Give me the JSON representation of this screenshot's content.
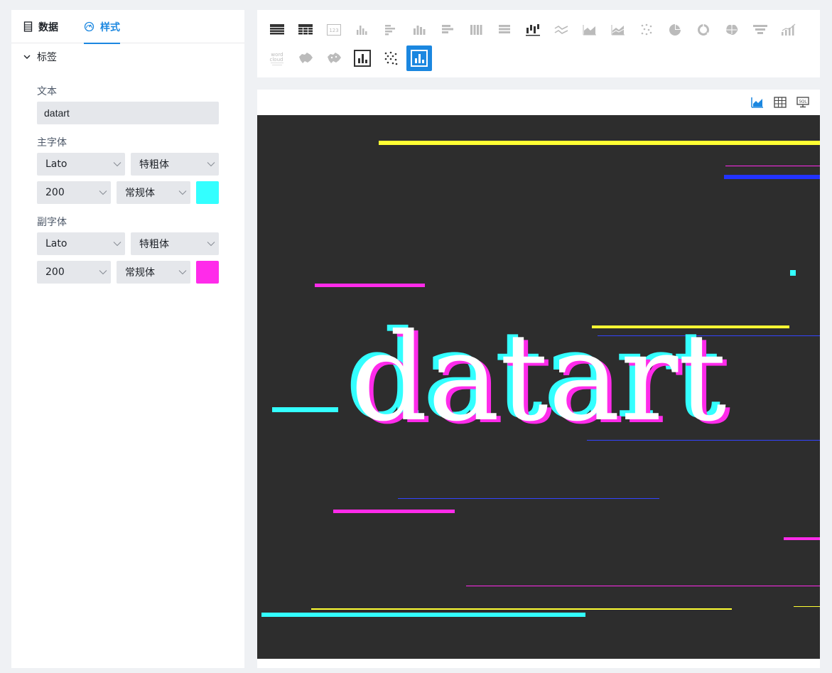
{
  "tabs": {
    "data": "数据",
    "style": "样式"
  },
  "section": {
    "label": "标签"
  },
  "fields": {
    "text_label": "文本",
    "text_value": "datart",
    "main_font_label": "主字体",
    "sub_font_label": "副字体"
  },
  "main_font": {
    "family": "Lato",
    "weight": "特粗体",
    "size": "200",
    "style": "常规体",
    "color": "#33ffff"
  },
  "sub_font": {
    "family": "Lato",
    "weight": "特粗体",
    "size": "200",
    "style": "常规体",
    "color": "#ff2bea"
  },
  "chart_icons": [
    "basic-table-icon",
    "pivot-table-icon",
    "scorecard-icon",
    "cluster-column-icon",
    "cluster-bar-icon",
    "stack-column-icon",
    "stack-bar-icon",
    "percent-column-icon",
    "percent-bar-icon",
    "waterfall-icon",
    "line-icon",
    "area-icon",
    "stack-area-icon",
    "scatter-icon",
    "pie-icon",
    "doughnut-icon",
    "rose-icon",
    "funnel-icon",
    "double-y-icon",
    "word-cloud-icon",
    "map-icon",
    "scatter-map-icon",
    "custom-chart-icon",
    "dot-matrix-icon",
    "glitch-chart-icon"
  ],
  "word_cloud_text": [
    "word",
    "cloud"
  ],
  "preview_text": "datart"
}
